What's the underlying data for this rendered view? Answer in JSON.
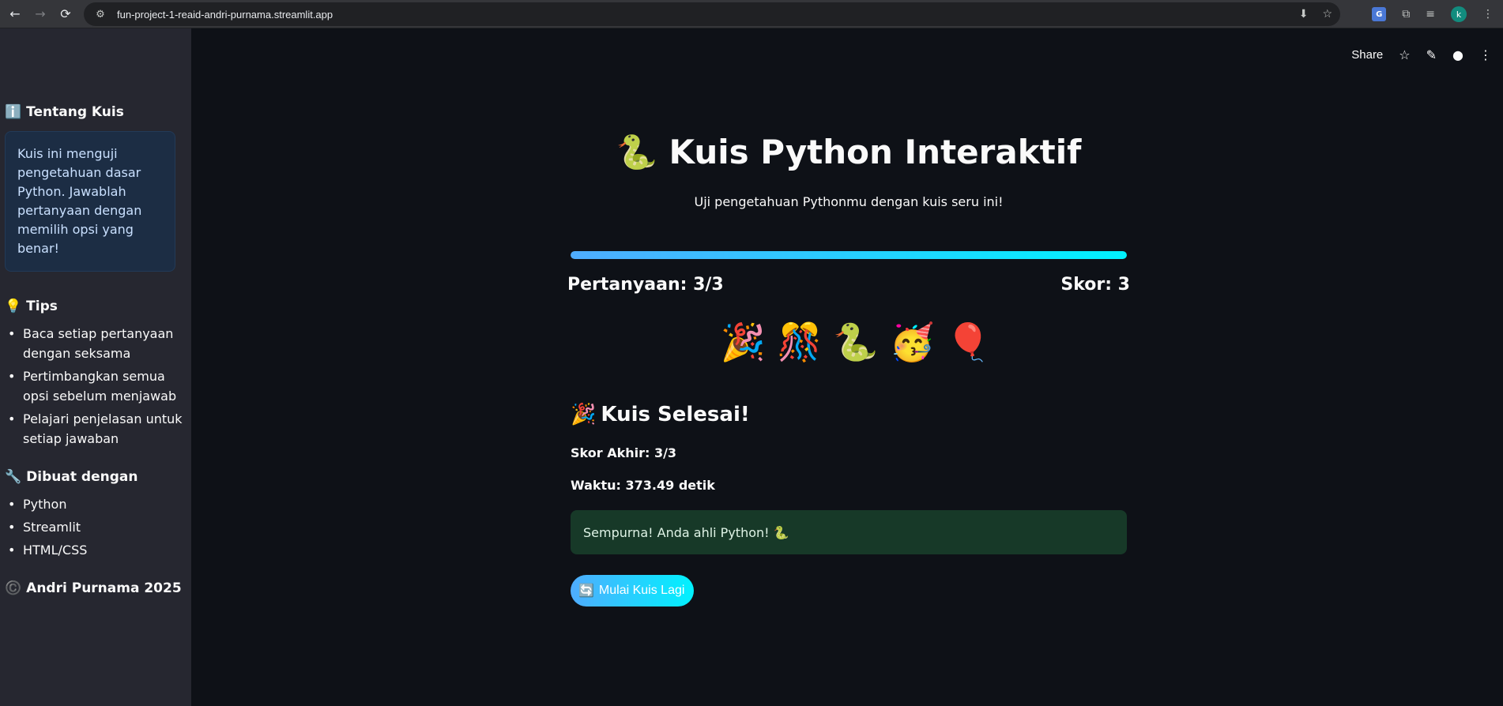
{
  "browser": {
    "url": "fun-project-1-reaid-andri-purnama.streamlit.app",
    "avatar_letter": "k",
    "icons": [
      "back-icon",
      "forward-icon",
      "reload-icon",
      "site-settings-icon",
      "install-app-icon",
      "bookmark-star-icon",
      "google-translate-icon",
      "extensions-icon",
      "media-control-icon",
      "avatar"
    ]
  },
  "sidebar": {
    "about": {
      "icon": "ℹ️",
      "title": "Tentang Kuis",
      "text": "Kuis ini menguji pengetahuan dasar Python. Jawablah pertanyaan dengan memilih opsi yang benar!"
    },
    "tips": {
      "icon": "💡",
      "title": "Tips",
      "items": [
        "Baca setiap pertanyaan dengan seksama",
        "Pertimbangkan semua opsi sebelum menjawab",
        "Pelajari penjelasan untuk setiap jawaban"
      ]
    },
    "built_with": {
      "icon": "🔧",
      "title": "Dibuat dengan",
      "items": [
        "Python",
        "Streamlit",
        "HTML/CSS"
      ]
    },
    "footer": {
      "icon": "©️",
      "text": "Andri Purnama 2025"
    }
  },
  "toolbar": {
    "share_label": "Share"
  },
  "main": {
    "title_icon": "🐍",
    "title": "Kuis Python Interaktif",
    "subtitle": "Uji pengetahuan Pythonmu dengan kuis seru ini!",
    "progress": 1.0,
    "question_label": "Pertanyaan: 3/3",
    "score_label": "Skor: 3",
    "emojis": [
      "🎉",
      "🎊",
      "🐍",
      "🥳",
      "🎈"
    ],
    "done_icon": "🎉",
    "done_title": "Kuis Selesai!",
    "final_score": "Skor Akhir: 3/3",
    "time": "Waktu: 373.49 detik",
    "success_message": "Sempurna! Anda ahli Python! 🐍",
    "restart_icon": "🔄",
    "restart_label": "Mulai Kuis Lagi"
  },
  "colors": {
    "accent_start": "#4facfe",
    "accent_end": "#00f2fe",
    "success_bg": "#173928",
    "info_bg": "#1c2d44"
  }
}
